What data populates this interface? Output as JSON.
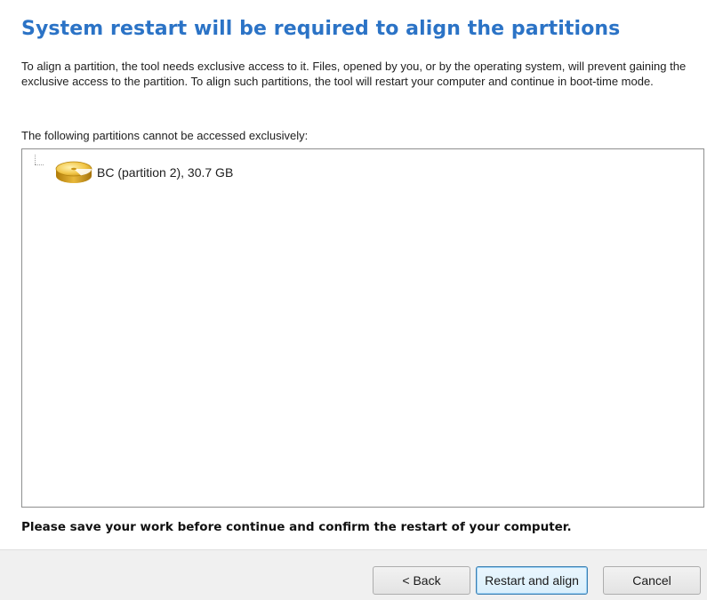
{
  "header": {
    "title": "System restart will be required to align the partitions"
  },
  "description": "To align a partition, the tool needs exclusive access to it. Files, opened by you, or by the operating system, will prevent gaining the exclusive access to the partition. To align such partitions, the tool will restart your computer and continue in boot-time mode.",
  "partition_list": {
    "label": "The following partitions cannot be accessed exclusively:",
    "items": [
      {
        "icon": "disk-partition-icon",
        "label": "BC (partition 2), 30.7 GB"
      }
    ]
  },
  "warning": "Please save your work before continue and confirm the restart of your computer.",
  "buttons": {
    "back": "< Back",
    "restart": "Restart and align",
    "cancel": "Cancel"
  },
  "colors": {
    "title": "#2b73c6",
    "footer_bg": "#f0f0f0",
    "disk_icon": "#e0a91a"
  }
}
